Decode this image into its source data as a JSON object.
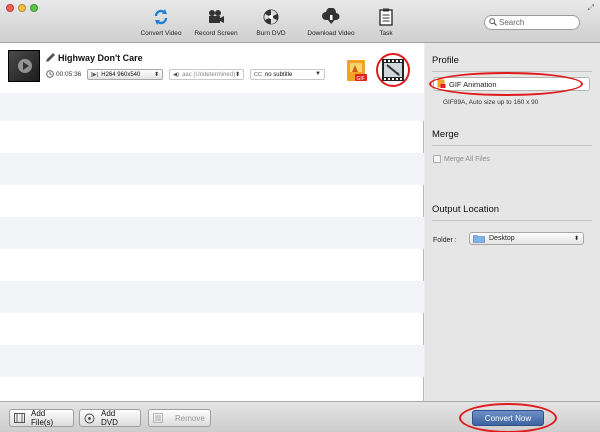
{
  "toolbar": {
    "items": [
      {
        "label": "Convert Video",
        "icon": "refresh-icon"
      },
      {
        "label": "Record Screen",
        "icon": "camera-icon"
      },
      {
        "label": "Burn DVD",
        "icon": "disc-icon"
      },
      {
        "label": "Download Video",
        "icon": "cloud-download-icon"
      },
      {
        "label": "Task",
        "icon": "clipboard-icon"
      }
    ],
    "search_placeholder": "Search"
  },
  "file_item": {
    "title": "Highway Don't Care",
    "duration": "00:05:36",
    "video_track": "H264 960x540",
    "audio_track": "aac (Undetermined)",
    "subtitle": "no subtitle",
    "audio_prefix": "◀)",
    "subtitle_prefix": "CC"
  },
  "panel": {
    "profile_heading": "Profile",
    "profile_value": "GIF Animation",
    "profile_desc": "GIF89A, Auto size up to 160 x 90",
    "merge_heading": "Merge",
    "merge_label": "Merge All Files",
    "merge_checked": false,
    "output_heading": "Output Location",
    "folder_label": "Folder :",
    "folder_value": "Desktop"
  },
  "bottom": {
    "add_files": "Add File(s)",
    "add_dvd": "Add DVD",
    "remove": "Remove",
    "convert_now": "Convert Now"
  },
  "colors": {
    "annotation_circle": "#e01a1a",
    "convert_button": "#4a6fae",
    "toolbar_icon": "#1f7fd6"
  }
}
